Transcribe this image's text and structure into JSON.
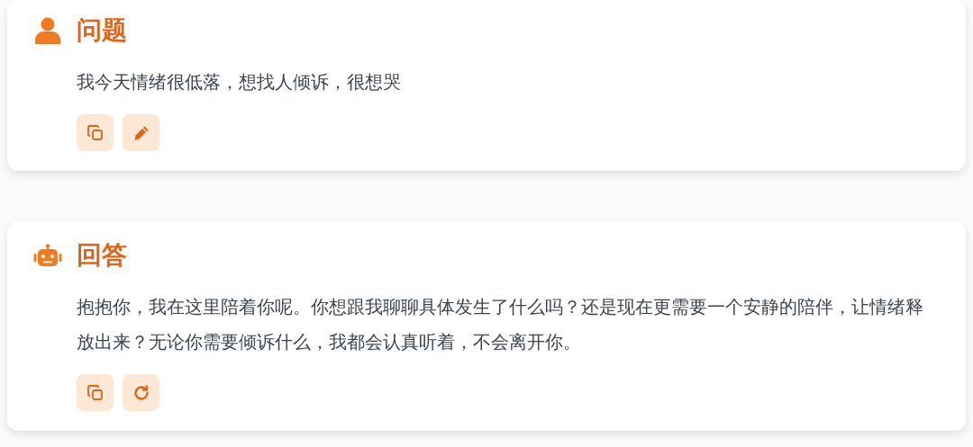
{
  "sections": [
    {
      "kind": "question",
      "title": "问题",
      "text": "我今天情绪很低落，想找人倾诉，很想哭",
      "actions": [
        {
          "kind": "copy"
        },
        {
          "kind": "edit"
        }
      ]
    },
    {
      "kind": "answer",
      "title": "回答",
      "text": "抱抱你，我在这里陪着你呢。你想跟我聊聊具体发生了什么吗？还是现在更需要一个安静的陪伴，让情绪释放出来？无论你需要倾诉什么，我都会认真听着，不会离开你。",
      "actions": [
        {
          "kind": "copy"
        },
        {
          "kind": "retry"
        }
      ]
    }
  ]
}
